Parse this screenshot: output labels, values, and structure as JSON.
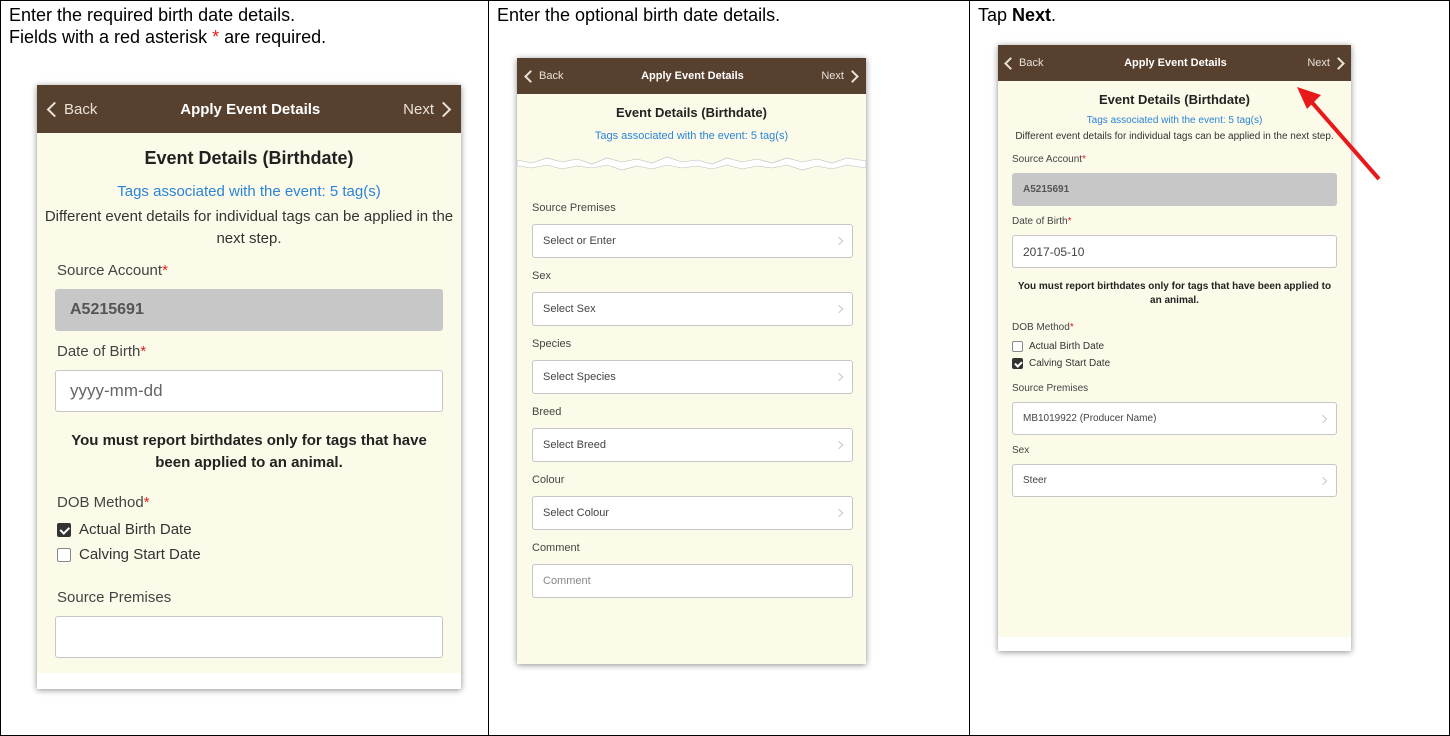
{
  "step1": {
    "instruction_line1": "Enter the required birth date details.",
    "instruction_line2_prefix": "Fields with a red asterisk ",
    "asterisk": "*",
    "instruction_line2_suffix": " are required.",
    "phone": {
      "back": "Back",
      "title": "Apply Event Details",
      "next": "Next",
      "heading": "Event Details (Birthdate)",
      "tags_link": "Tags associated with the event: 5 tag(s)",
      "note": "Different event details for individual tags can be applied in the next step.",
      "source_account_label": "Source Account",
      "source_account_value": "A5215691",
      "dob_label": "Date of Birth",
      "dob_placeholder": "yyyy-mm-dd",
      "warning": "You must report birthdates only for tags that have been applied to an animal.",
      "dob_method_label": "DOB Method",
      "option_actual": "Actual Birth Date",
      "option_calving": "Calving Start Date",
      "source_premises_label": "Source Premises",
      "required_mark": "*"
    }
  },
  "step2": {
    "instruction": "Enter the optional birth date details.",
    "phone": {
      "back": "Back",
      "title": "Apply Event Details",
      "next": "Next",
      "heading": "Event Details (Birthdate)",
      "tags_link": "Tags associated with the event: 5 tag(s)",
      "fields": [
        {
          "label": "Source Premises",
          "value": "Select or Enter"
        },
        {
          "label": "Sex",
          "value": "Select Sex"
        },
        {
          "label": "Species",
          "value": "Select Species"
        },
        {
          "label": "Breed",
          "value": "Select Breed"
        },
        {
          "label": "Colour",
          "value": "Select Colour"
        }
      ],
      "comment_label": "Comment",
      "comment_placeholder": "Comment"
    }
  },
  "step3": {
    "instruction_prefix": "Tap ",
    "instruction_bold": "Next",
    "instruction_suffix": ".",
    "phone": {
      "back": "Back",
      "title": "Apply Event Details",
      "next": "Next",
      "heading": "Event Details (Birthdate)",
      "tags_link": "Tags associated with the event: 5 tag(s)",
      "note": "Different event details for individual tags can be applied in the next step.",
      "source_account_label": "Source Account",
      "source_account_value": "A5215691",
      "dob_label": "Date of Birth",
      "dob_value": "2017-05-10",
      "warning": "You must report birthdates only for tags that have been applied to an animal.",
      "dob_method_label": "DOB Method",
      "option_actual": "Actual Birth Date",
      "option_calving": "Calving Start Date",
      "source_premises_label": "Source Premises",
      "source_premises_value": "MB1019922 (Producer Name)",
      "sex_label": "Sex",
      "sex_value": "Steer",
      "required_mark": "*"
    }
  },
  "colors": {
    "nav_bar": "#58402f",
    "screen_bg": "#fcfbe9",
    "link_blue": "#2a84d8",
    "required_red": "#e02020",
    "arrow_red": "#e8191a"
  }
}
